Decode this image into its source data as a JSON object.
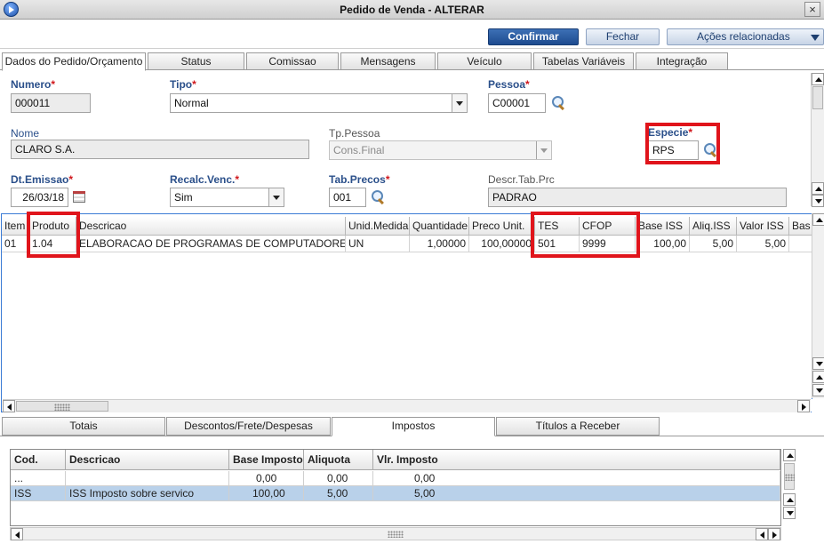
{
  "window": {
    "title": "Pedido de Venda - ALTERAR",
    "close": "×"
  },
  "toolbar": {
    "confirm": "Confirmar",
    "close": "Fechar",
    "actions": "Ações relacionadas"
  },
  "tabs": [
    "Dados do Pedido/Orçamento",
    "Status",
    "Comissao",
    "Mensagens",
    "Veículo",
    "Tabelas Variáveis",
    "Integração"
  ],
  "form": {
    "numero": {
      "label": "Numero",
      "value": "000011"
    },
    "tipo": {
      "label": "Tipo",
      "value": "Normal"
    },
    "pessoa": {
      "label": "Pessoa",
      "value": "C00001"
    },
    "nome": {
      "label": "Nome",
      "value": "CLARO S.A."
    },
    "tp_pessoa": {
      "label": "Tp.Pessoa",
      "value": "Cons.Final"
    },
    "especie": {
      "label": "Especie",
      "value": "RPS"
    },
    "dt_emissao": {
      "label": "Dt.Emissao",
      "value": "26/03/18"
    },
    "recalc_venc": {
      "label": "Recalc.Venc.",
      "value": "Sim"
    },
    "tab_precos": {
      "label": "Tab.Precos",
      "value": "001"
    },
    "descr_tab_prc": {
      "label": "Descr.Tab.Prc",
      "value": "PADRAO"
    },
    "required_mark": "*"
  },
  "items_grid": {
    "headers": [
      "Item",
      "Produto",
      "Descricao",
      "Unid.Medida",
      "Quantidade",
      "Preco Unit.",
      "TES",
      "CFOP",
      "Base ISS",
      "Aliq.ISS",
      "Valor ISS",
      "Bas"
    ],
    "rows": [
      [
        "01",
        "1.04",
        "ELABORACAO DE PROGRAMAS DE COMPUTADORES",
        "UN",
        "1,00000",
        "100,00000",
        "501",
        "9999",
        "100,00",
        "5,00",
        "5,00",
        ""
      ]
    ]
  },
  "bottom_tabs": [
    "Totais",
    "Descontos/Frete/Despesas",
    "Impostos",
    "Títulos a Receber"
  ],
  "taxes_grid": {
    "headers": [
      "Cod.",
      "Descricao",
      "Base Imposto",
      "Aliquota",
      "Vlr. Imposto"
    ],
    "rows": [
      [
        "...",
        "",
        "0,00",
        "0,00",
        "0,00"
      ],
      [
        "ISS",
        "ISS Imposto sobre servico",
        "100,00",
        "5,00",
        "5,00"
      ]
    ]
  },
  "colors": {
    "accent": "#1d4b8f",
    "label": "#2a4f8a",
    "required": "#d0161b",
    "highlight": "#e0141b",
    "selected_row": "#b9d1ea"
  }
}
